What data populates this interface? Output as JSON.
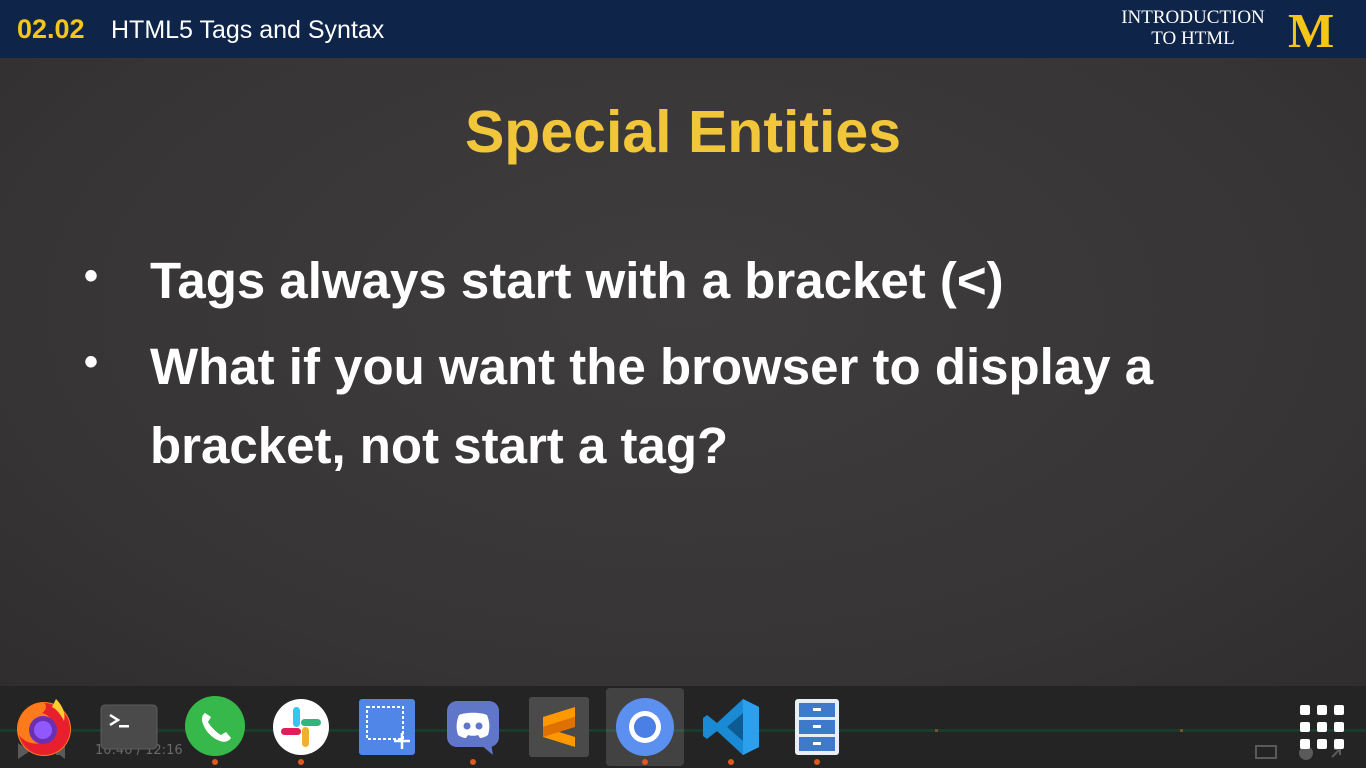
{
  "header": {
    "lesson_number": "02.02",
    "lesson_title": "HTML5 Tags and Syntax",
    "course_line1": "INTRODUCTION",
    "course_line2": "TO HTML",
    "logo_letter": "M"
  },
  "slide": {
    "title": "Special Entities",
    "bullets": [
      "Tags always start with a bracket (<)",
      "What if you want the browser to display a bracket, not start a tag?"
    ],
    "bullet_symbol": "•"
  },
  "player": {
    "current_time": "10:40",
    "separator": "/",
    "total_time": "12:16"
  },
  "dock": {
    "apps": [
      {
        "name": "firefox",
        "icon": "firefox-icon",
        "running": false
      },
      {
        "name": "terminal",
        "icon": "terminal-icon",
        "running": false
      },
      {
        "name": "whatsapp",
        "icon": "whatsapp-icon",
        "running": true
      },
      {
        "name": "slack",
        "icon": "slack-icon",
        "running": true
      },
      {
        "name": "screenshot",
        "icon": "screenshot-icon",
        "running": false
      },
      {
        "name": "discord",
        "icon": "discord-icon",
        "running": true
      },
      {
        "name": "sublime-text",
        "icon": "sublime-icon",
        "running": false
      },
      {
        "name": "chromium",
        "icon": "chromium-icon",
        "running": true,
        "active": true
      },
      {
        "name": "vscode",
        "icon": "vscode-icon",
        "running": true
      },
      {
        "name": "file-manager",
        "icon": "file-cabinet-icon",
        "running": true
      }
    ],
    "show_apps_icon": "app-grid-icon"
  },
  "colors": {
    "header_bg": "#0e2549",
    "accent_gold": "#f5c518",
    "slide_bg": "#3a3838",
    "title_gold": "#f2c63a",
    "progress_green": "#1f6b45",
    "running_dot": "#e0581d"
  }
}
